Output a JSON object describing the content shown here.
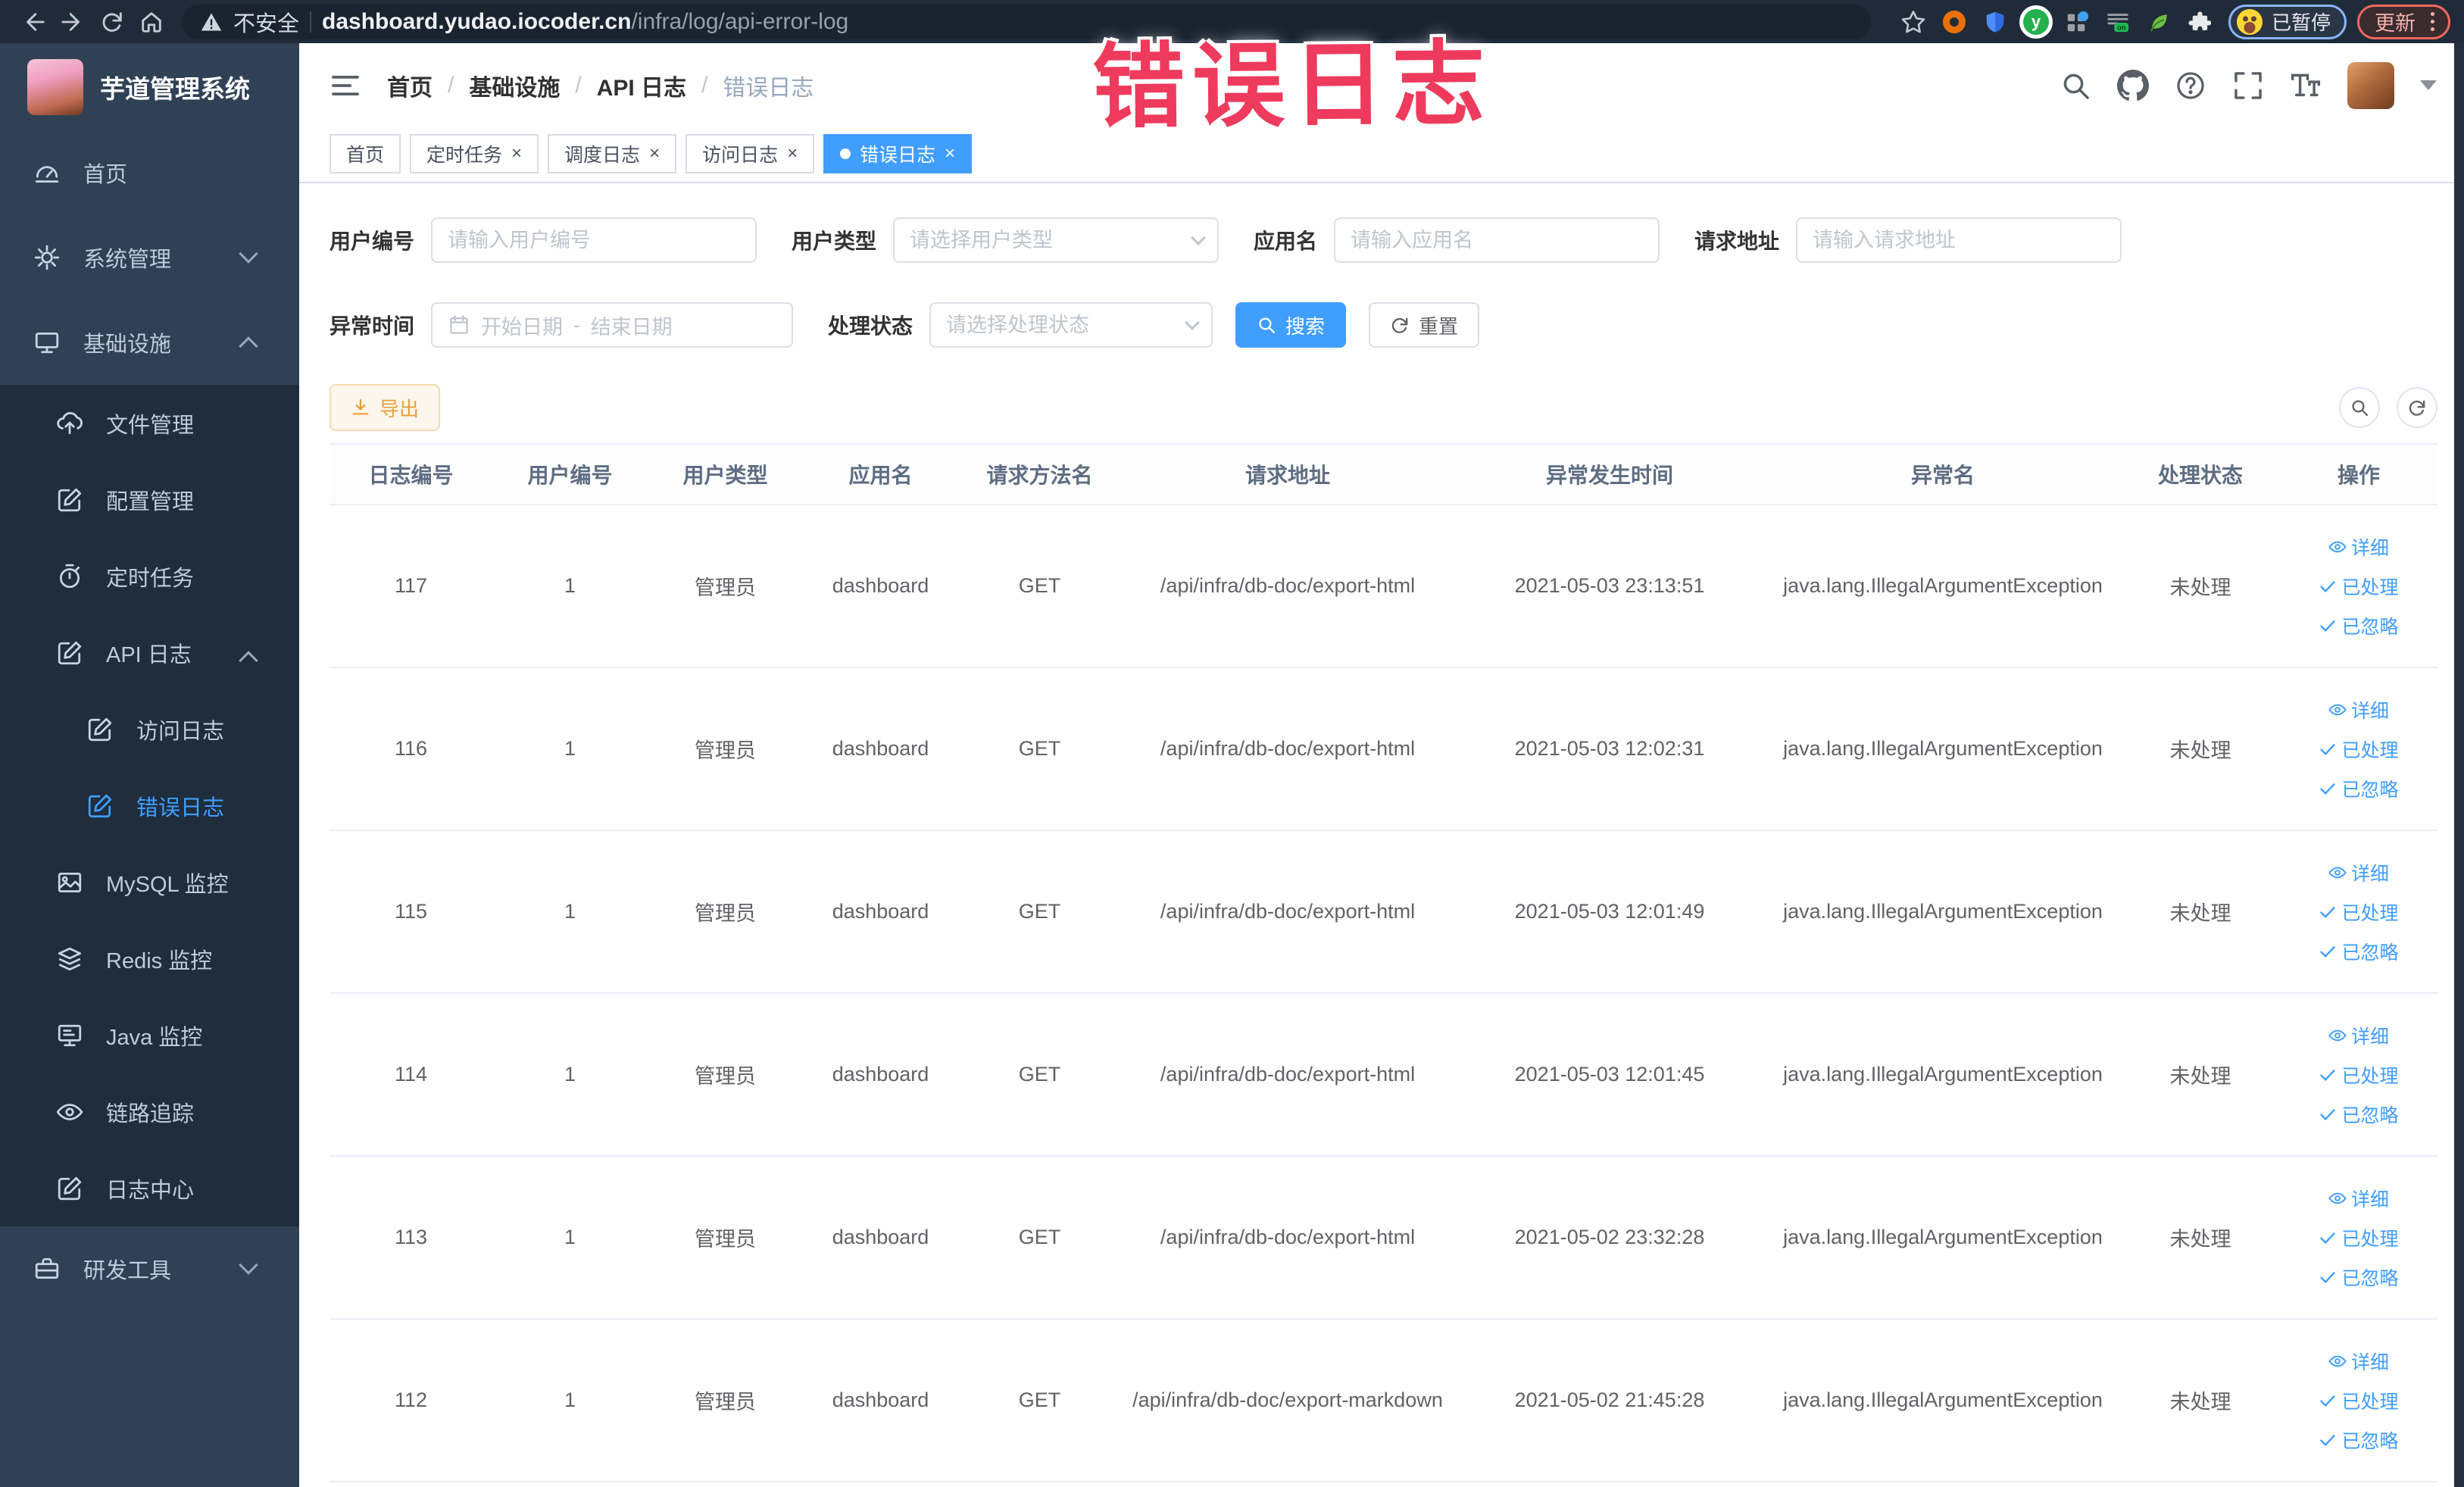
{
  "colors": {
    "accent": "#409eff",
    "warning": "#e6a23c",
    "annotation_red": "#ee3a5c",
    "sidebar_bg": "#304156",
    "submenu_bg": "#1f2d3d",
    "browser_bar_bg": "#202b39"
  },
  "annotation": {
    "text": "错误日志"
  },
  "browser": {
    "security_label": "不安全",
    "url_domain": "dashboard.yudao.iocoder.cn",
    "url_path": "/infra/log/api-error-log",
    "extension_badge": "on",
    "profile_chip_label": "已暂停",
    "update_button_label": "更新"
  },
  "sidebar": {
    "logo_title": "芋道管理系统",
    "items": [
      {
        "label": "首页"
      },
      {
        "label": "系统管理"
      },
      {
        "label": "基础设施"
      },
      {
        "label": "文件管理"
      },
      {
        "label": "配置管理"
      },
      {
        "label": "定时任务"
      },
      {
        "label": "API 日志"
      },
      {
        "label": "访问日志"
      },
      {
        "label": "错误日志"
      },
      {
        "label": "MySQL 监控"
      },
      {
        "label": "Redis 监控"
      },
      {
        "label": "Java 监控"
      },
      {
        "label": "链路追踪"
      },
      {
        "label": "日志中心"
      },
      {
        "label": "研发工具"
      }
    ]
  },
  "breadcrumb": {
    "items": [
      "首页",
      "基础设施",
      "API 日志",
      "错误日志"
    ],
    "separator": "/"
  },
  "tabs": [
    {
      "label": "首页"
    },
    {
      "label": "定时任务"
    },
    {
      "label": "调度日志"
    },
    {
      "label": "访问日志"
    },
    {
      "label": "错误日志"
    }
  ],
  "filters": {
    "user_id": {
      "label": "用户编号",
      "placeholder": "请输入用户编号"
    },
    "user_type": {
      "label": "用户类型",
      "placeholder": "请选择用户类型"
    },
    "app_name": {
      "label": "应用名",
      "placeholder": "请输入应用名"
    },
    "request_url": {
      "label": "请求地址",
      "placeholder": "请输入请求地址"
    },
    "exception_time": {
      "label": "异常时间",
      "start_placeholder": "开始日期",
      "separator": "-",
      "end_placeholder": "结束日期"
    },
    "process_status": {
      "label": "处理状态",
      "placeholder": "请选择处理状态"
    },
    "search_label": "搜索",
    "reset_label": "重置"
  },
  "toolbar": {
    "export_label": "导出"
  },
  "table": {
    "columns": [
      "日志编号",
      "用户编号",
      "用户类型",
      "应用名",
      "请求方法名",
      "请求地址",
      "异常发生时间",
      "异常名",
      "处理状态",
      "操作"
    ],
    "actions": [
      "详细",
      "已处理",
      "已忽略"
    ],
    "rows": [
      {
        "id": "117",
        "user_id": "1",
        "user_type": "管理员",
        "app": "dashboard",
        "method": "GET",
        "url": "/api/infra/db-doc/export-html",
        "time": "2021-05-03 23:13:51",
        "exception": "java.lang.IllegalArgumentException",
        "status": "未处理"
      },
      {
        "id": "116",
        "user_id": "1",
        "user_type": "管理员",
        "app": "dashboard",
        "method": "GET",
        "url": "/api/infra/db-doc/export-html",
        "time": "2021-05-03 12:02:31",
        "exception": "java.lang.IllegalArgumentException",
        "status": "未处理"
      },
      {
        "id": "115",
        "user_id": "1",
        "user_type": "管理员",
        "app": "dashboard",
        "method": "GET",
        "url": "/api/infra/db-doc/export-html",
        "time": "2021-05-03 12:01:49",
        "exception": "java.lang.IllegalArgumentException",
        "status": "未处理"
      },
      {
        "id": "114",
        "user_id": "1",
        "user_type": "管理员",
        "app": "dashboard",
        "method": "GET",
        "url": "/api/infra/db-doc/export-html",
        "time": "2021-05-03 12:01:45",
        "exception": "java.lang.IllegalArgumentException",
        "status": "未处理"
      },
      {
        "id": "113",
        "user_id": "1",
        "user_type": "管理员",
        "app": "dashboard",
        "method": "GET",
        "url": "/api/infra/db-doc/export-html",
        "time": "2021-05-02 23:32:28",
        "exception": "java.lang.IllegalArgumentException",
        "status": "未处理"
      },
      {
        "id": "112",
        "user_id": "1",
        "user_type": "管理员",
        "app": "dashboard",
        "method": "GET",
        "url": "/api/infra/db-doc/export-markdown",
        "time": "2021-05-02 21:45:28",
        "exception": "java.lang.IllegalArgumentException",
        "status": "未处理"
      }
    ]
  }
}
